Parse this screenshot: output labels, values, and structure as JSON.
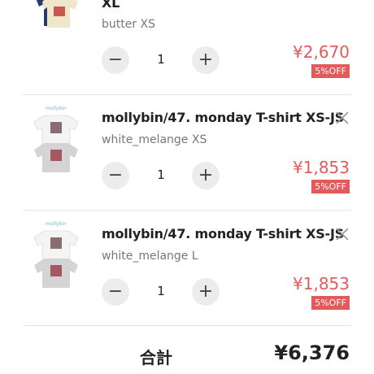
{
  "cart": {
    "items": [
      {
        "title": "XL",
        "variant": "butter XS",
        "quantity": "1",
        "price": "¥2,670",
        "discount": "5%OFF",
        "thumb_icon": "tshirt-image"
      },
      {
        "title": "mollybin/47. monday T-shirt XS-JS",
        "variant": "white_melange XS",
        "quantity": "1",
        "price": "¥1,853",
        "discount": "5%OFF",
        "thumb_icon": "tshirt-image"
      },
      {
        "title": "mollybin/47. monday T-shirt XS-JS",
        "variant": "white_melange L",
        "quantity": "1",
        "price": "¥1,853",
        "discount": "5%OFF",
        "thumb_icon": "tshirt-image"
      }
    ],
    "quantity_controls": {
      "minus": "−",
      "plus": "+"
    },
    "icons": {
      "remove": "close-icon"
    },
    "colors": {
      "accent": "#e25a5a",
      "text": "#222222",
      "muted": "#777777",
      "button_bg": "#ececec"
    }
  },
  "summary": {
    "total_label": "合計",
    "total_value": "¥6,376"
  }
}
